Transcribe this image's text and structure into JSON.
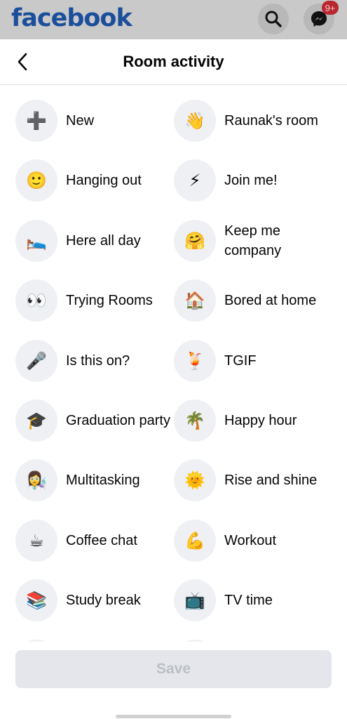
{
  "app": {
    "logo": "facebook",
    "messenger_badge": "9+"
  },
  "sheet": {
    "title": "Room activity",
    "save_label": "Save"
  },
  "icons": {
    "back": "back-arrow-icon",
    "search": "search-icon",
    "messenger": "messenger-icon"
  },
  "colors": {
    "brand": "#1b4e9b",
    "circle_bg": "#eff0f3",
    "save_bg": "#e4e6eb",
    "save_text": "#bcc0c4"
  },
  "activities": [
    {
      "emoji": "➕",
      "label": "New"
    },
    {
      "emoji": "👋",
      "label": "Raunak's room"
    },
    {
      "emoji": "🙂",
      "label": "Hanging out"
    },
    {
      "emoji": "⚡",
      "label": "Join me!"
    },
    {
      "emoji": "🛌",
      "label": "Here all day"
    },
    {
      "emoji": "🤗",
      "label": "Keep me company"
    },
    {
      "emoji": "👀",
      "label": "Trying Rooms"
    },
    {
      "emoji": "🏠",
      "label": "Bored at home"
    },
    {
      "emoji": "🎤",
      "label": "Is this on?"
    },
    {
      "emoji": "🍹",
      "label": "TGIF"
    },
    {
      "emoji": "🎓",
      "label": "Graduation party"
    },
    {
      "emoji": "🌴",
      "label": "Happy hour"
    },
    {
      "emoji": "👩‍🔬",
      "label": "Multitasking"
    },
    {
      "emoji": "🌞",
      "label": "Rise and shine"
    },
    {
      "emoji": "☕",
      "label": "Coffee chat"
    },
    {
      "emoji": "💪",
      "label": "Workout"
    },
    {
      "emoji": "📚",
      "label": "Study break"
    },
    {
      "emoji": "📺",
      "label": "TV time"
    }
  ]
}
